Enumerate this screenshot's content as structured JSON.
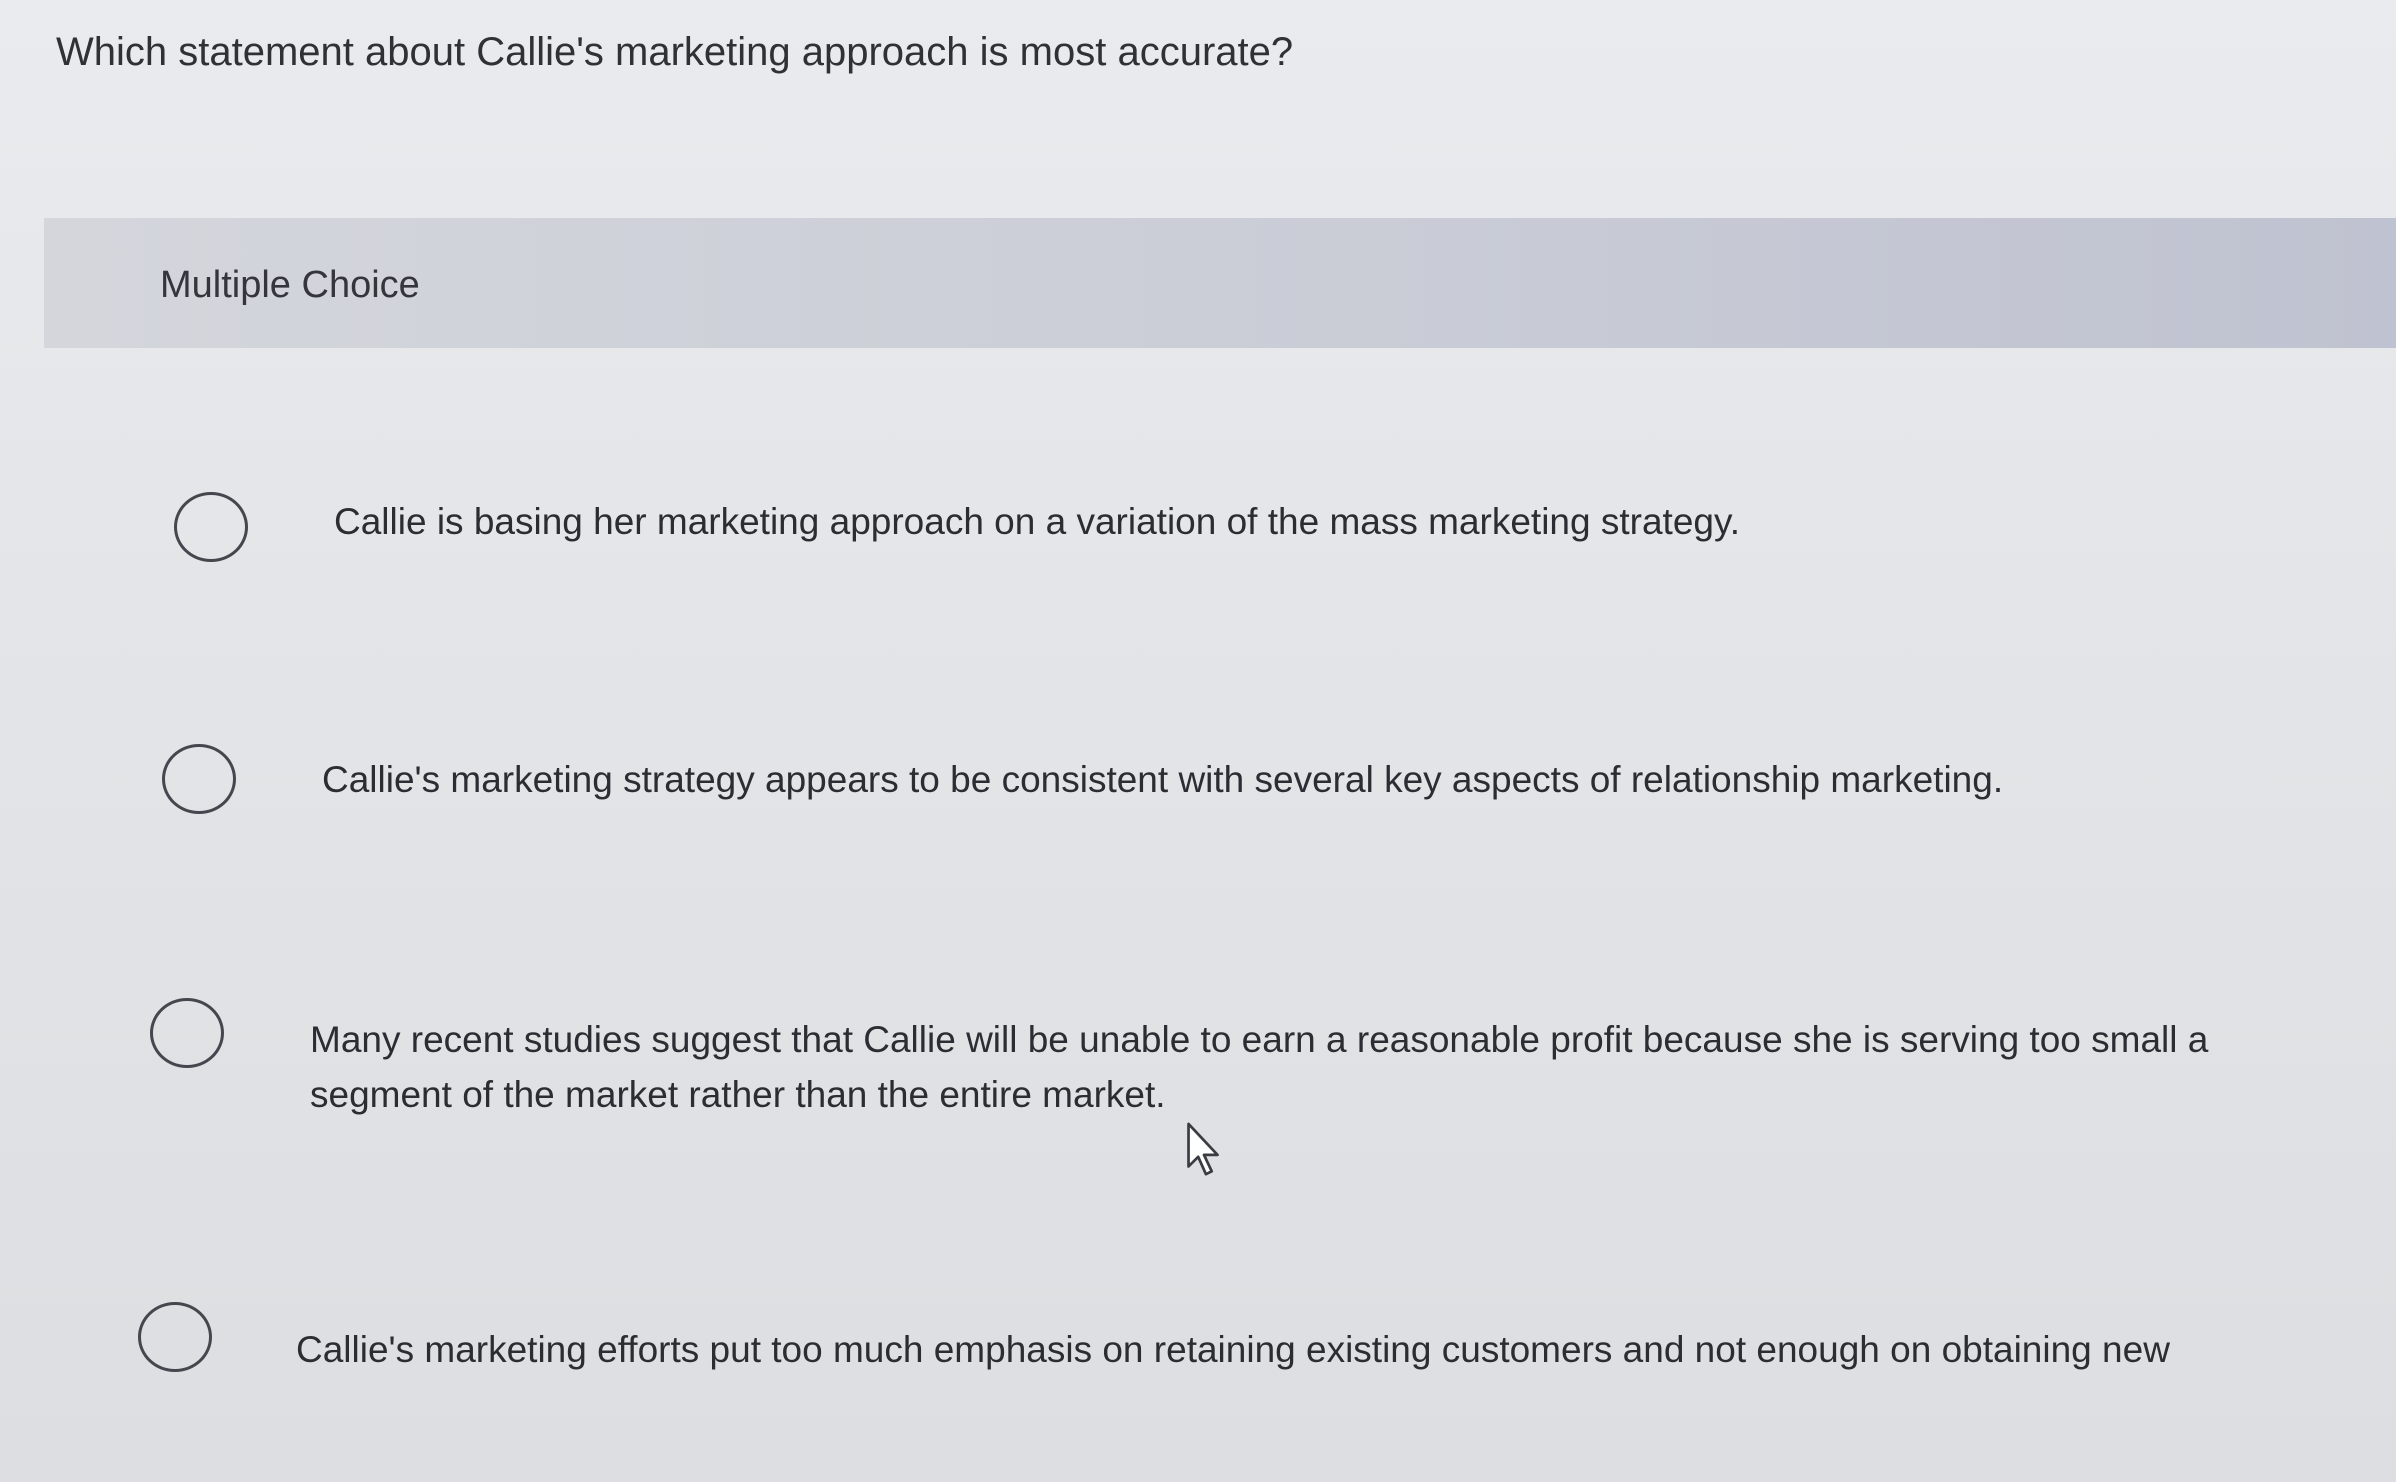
{
  "question": {
    "text": "Which statement about Callie's marketing approach is most accurate?"
  },
  "multiple_choice": {
    "header": "Multiple Choice",
    "options": [
      {
        "label": "Callie is basing her marketing approach on a variation of the mass marketing strategy."
      },
      {
        "label": "Callie's marketing strategy appears to be consistent with several key aspects of relationship marketing."
      },
      {
        "label": "Many recent studies suggest that Callie will be unable to earn a reasonable profit because she is serving too small a segment of the market rather than the entire market."
      },
      {
        "label": "Callie's marketing efforts put too much emphasis on retaining existing customers and not enough on obtaining new"
      }
    ]
  },
  "icons": {
    "radio": "radio-button-icon",
    "cursor": "mouse-pointer-icon"
  },
  "colors": {
    "header_band": "#c9ccd6",
    "background": "#e3e5e8",
    "text": "#2b2d33"
  }
}
